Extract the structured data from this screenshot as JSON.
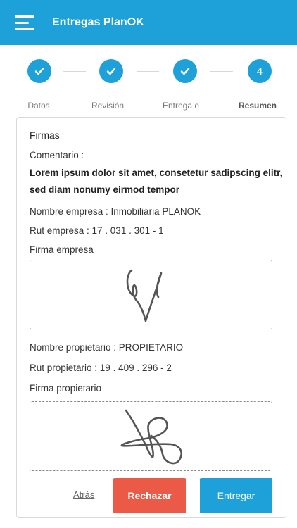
{
  "app": {
    "title": "Entregas PlanOK",
    "accent_color": "#1da1d8",
    "menu_icon": "hamburger-menu-icon"
  },
  "stepper": {
    "steps": [
      {
        "label": "Datos",
        "state": "done",
        "icon": "check-icon"
      },
      {
        "label": "Revisión",
        "state": "done",
        "icon": "check-icon"
      },
      {
        "label": "Entrega e",
        "state": "done",
        "icon": "check-icon"
      },
      {
        "label": "Resumen",
        "state": "active",
        "number": "4"
      }
    ]
  },
  "card": {
    "section_title": "Firmas",
    "comment_label": "Comentario :",
    "comment_text": "Lorem ipsum dolor sit amet, consetetur sadipscing elitr, sed diam nonumy eirmod tempor",
    "company_name": "Nombre empresa : Inmobiliaria PLANOK",
    "company_rut": "Rut empresa : 17 . 031 . 301 - 1",
    "company_signature_label": "Firma empresa",
    "owner_name": "Nombre propietario : PROPIETARIO",
    "owner_rut": "Rut propietario : 19 . 409 . 296 - 2",
    "owner_signature_label": "Firma propietario"
  },
  "actions": {
    "back_label": "Atrás",
    "reject_label": "Rechazar",
    "deliver_label": "Entregar",
    "reject_color": "#ea5a47"
  }
}
